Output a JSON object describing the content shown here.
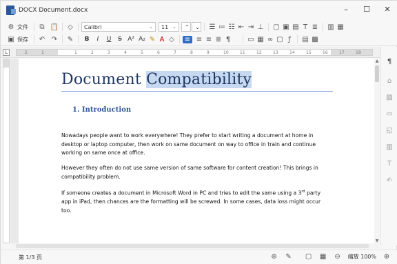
{
  "window": {
    "title": "DOCX Document.docx",
    "controls": {
      "minimize": "–",
      "maximize": "☐",
      "close": "✕"
    }
  },
  "toolbar": {
    "file_label": "文件",
    "save_label": "保存",
    "font_name": "Calibri",
    "font_size": "11",
    "format_buttons": [
      "B",
      "I",
      "U",
      "S",
      "A²",
      "A₂"
    ]
  },
  "ruler": {
    "numbers": [
      "2",
      "1",
      "1",
      "2",
      "3",
      "4",
      "5",
      "6",
      "7",
      "8",
      "9",
      "10",
      "11",
      "12",
      "13",
      "14",
      "15",
      "16",
      "17",
      "18"
    ]
  },
  "document": {
    "title_plain": "Document ",
    "title_selected": "Compatibility",
    "heading": "1.  Introduction",
    "paragraphs": [
      "Nowadays people want to work everywhere! They prefer to start writing a document at home in desktop or laptop computer, then work on same document on way to office in train and continue working on same once at office.",
      "However they often do not use same version of same software for content creation! This brings in compatibility problem.",
      "If someone creates a document in Microsoft Word in PC and tries to edit the same using a 3",
      "rd",
      " party app in iPad, then chances are the formatting will be screwed. In some cases, data loss might occur too."
    ]
  },
  "status": {
    "page_info": "第 1/3 页",
    "zoom_label": "缩放 100%"
  },
  "colors": {
    "title": "#1f3864",
    "heading": "#2e5597",
    "selection": "#c6d9f0",
    "accent": "#2f6ec3"
  }
}
